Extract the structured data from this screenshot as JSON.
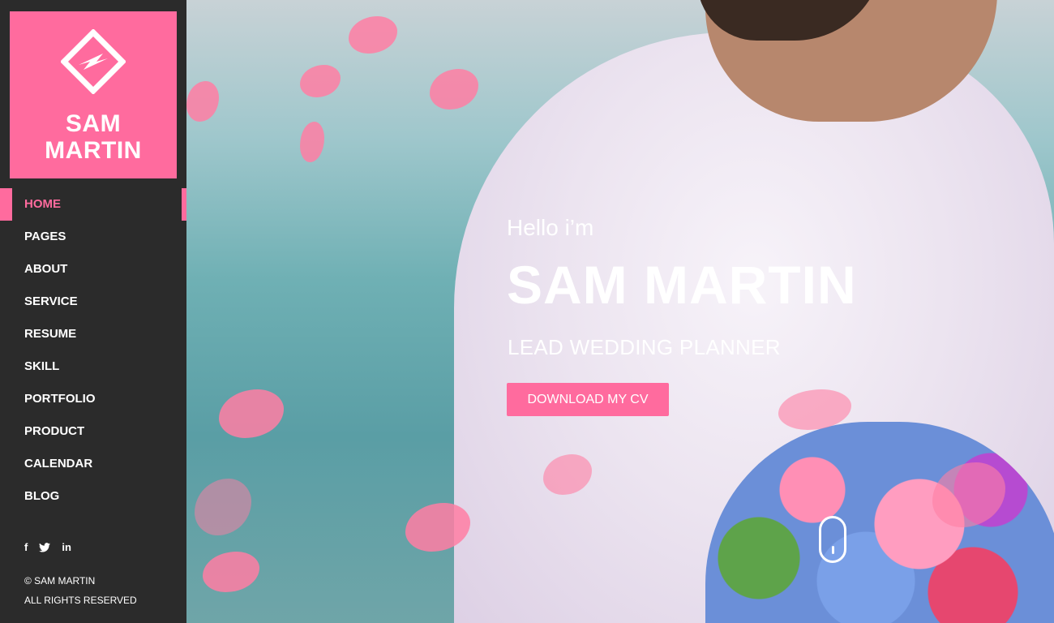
{
  "brand": {
    "line1": "SAM",
    "line2": "MARTIN"
  },
  "nav": [
    {
      "label": "HOME",
      "active": true
    },
    {
      "label": "PAGES"
    },
    {
      "label": "ABOUT"
    },
    {
      "label": "SERVICE"
    },
    {
      "label": "RESUME"
    },
    {
      "label": "SKILL"
    },
    {
      "label": "PORTFOLIO"
    },
    {
      "label": "PRODUCT"
    },
    {
      "label": "CALENDAR"
    },
    {
      "label": "BLOG"
    }
  ],
  "social": {
    "facebook": "f",
    "twitter": "twitter-icon",
    "linkedin": "in"
  },
  "footer": {
    "copyright": "© SAM MARTIN",
    "rights": "ALL RIGHTS RESERVED"
  },
  "hero": {
    "greeting": "Hello i’m",
    "name": "SAM MARTIN",
    "role": "LEAD WEDDING PLANNER",
    "cta": "DOWNLOAD MY CV"
  },
  "colors": {
    "accent": "#ff6b9e",
    "sidebar": "#2b2b2b",
    "text": "#ffffff"
  }
}
